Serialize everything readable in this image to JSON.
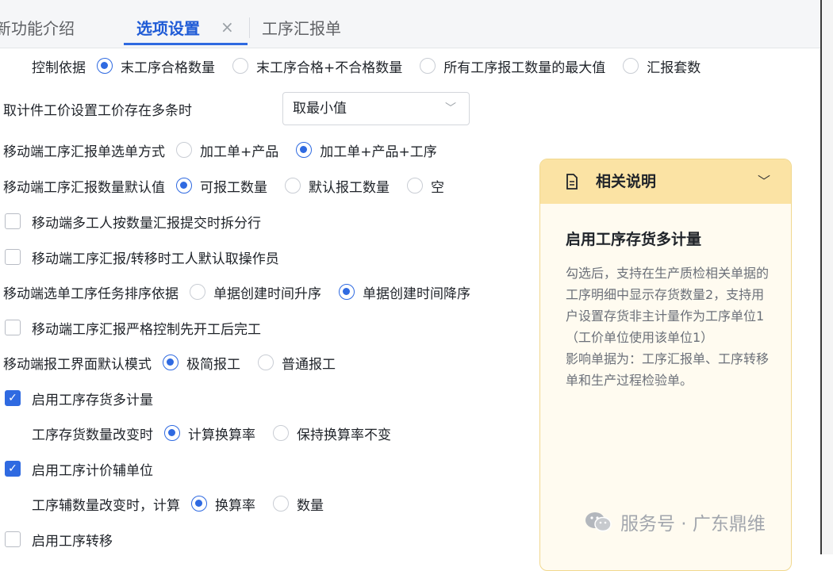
{
  "tabs": [
    {
      "label": "新功能介绍"
    },
    {
      "label": "选项设置",
      "close": "×"
    },
    {
      "label": "工序汇报单"
    }
  ],
  "control_basis": {
    "label": "控制依据",
    "options": [
      "末工序合格数量",
      "末工序合格+不合格数量",
      "所有工序报工数量的最大值",
      "汇报套数"
    ]
  },
  "price_setting": {
    "label": "取计件工价设置工价存在多条时",
    "value": "取最小值"
  },
  "select_mode": {
    "label": "移动端工序汇报单选单方式",
    "options": [
      "加工单+产品",
      "加工单+产品+工序"
    ]
  },
  "qty_default": {
    "label": "移动端工序汇报数量默认值",
    "options": [
      "可报工数量",
      "默认报工数量",
      "空"
    ]
  },
  "multi_worker_split": {
    "label": "移动端多工人按数量汇报提交时拆分行"
  },
  "default_operator": {
    "label": "移动端工序汇报/转移时工人默认取操作员"
  },
  "task_sort": {
    "label": "移动端选单工序任务排序依据",
    "options": [
      "单据创建时间升序",
      "单据创建时间降序"
    ]
  },
  "strict_control": {
    "label": "移动端工序汇报严格控制先开工后完工"
  },
  "report_mode": {
    "label": "移动端报工界面默认模式",
    "options": [
      "极简报工",
      "普通报工"
    ]
  },
  "multi_unit": {
    "label": "启用工序存货多计量"
  },
  "inv_qty_change": {
    "label": "工序存货数量改变时",
    "options": [
      "计算换算率",
      "保持换算率不变"
    ]
  },
  "aux_unit": {
    "label": "启用工序计价辅单位"
  },
  "aux_qty_change": {
    "label": "工序辅数量改变时，计算",
    "options": [
      "换算率",
      "数量"
    ]
  },
  "transfer": {
    "label": "启用工序转移"
  },
  "panel": {
    "title": "相关说明",
    "subtitle": "启用工序存货多计量",
    "body": "勾选后，支持在生产质检相关单据的工序明细中显示存货数量2，支持用户设置存货非主计量作为工序单位1（工价单位使用该单位1）",
    "body2": "影响单据为：工序汇报单、工序转移单和生产过程检验单。"
  },
  "watermark": {
    "text": "服务号 · 广东鼎维"
  },
  "colors": {
    "accent": "#2f6ae1",
    "panel_header": "#fbe3a4",
    "panel_bg": "#fffbf0"
  }
}
